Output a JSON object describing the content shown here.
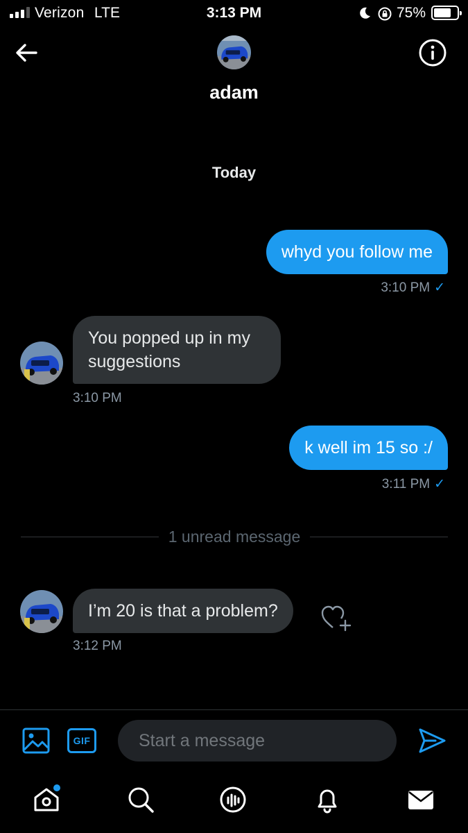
{
  "status_bar": {
    "carrier": "Verizon",
    "network": "LTE",
    "time": "3:13 PM",
    "battery_percent": "75%",
    "battery_level": 0.75,
    "icons": [
      "signal-icon",
      "moon-icon",
      "orientation-lock-icon",
      "battery-icon"
    ]
  },
  "header": {
    "name": "adam",
    "icons": [
      "back-arrow-icon",
      "info-icon"
    ]
  },
  "conversation": {
    "day_separator": "Today",
    "messages": [
      {
        "direction": "outgoing",
        "text": "whyd you follow me",
        "time": "3:10 PM",
        "receipt": "✓"
      },
      {
        "direction": "incoming",
        "text": "You popped up in my suggestions",
        "time": "3:10 PM"
      },
      {
        "direction": "outgoing",
        "text": "k well im 15 so :/",
        "time": "3:11 PM",
        "receipt": "✓"
      },
      {
        "direction": "incoming",
        "text": "I’m 20 is that a problem?",
        "time": "3:12 PM"
      }
    ],
    "unread_divider": "1 unread message"
  },
  "composer": {
    "placeholder": "Start a message",
    "gif_label": "GIF",
    "icons": [
      "image-icon",
      "gif-icon",
      "send-icon"
    ]
  },
  "tab_bar": {
    "items": [
      "home",
      "search",
      "spaces",
      "notifications",
      "messages"
    ],
    "icons": [
      "home-icon",
      "search-icon",
      "spaces-icon",
      "bell-icon",
      "mail-icon"
    ]
  },
  "colors": {
    "accent": "#1d9bf0",
    "incoming_bubble": "#2f3336",
    "background": "#000000",
    "muted_text": "#8b98a5"
  }
}
